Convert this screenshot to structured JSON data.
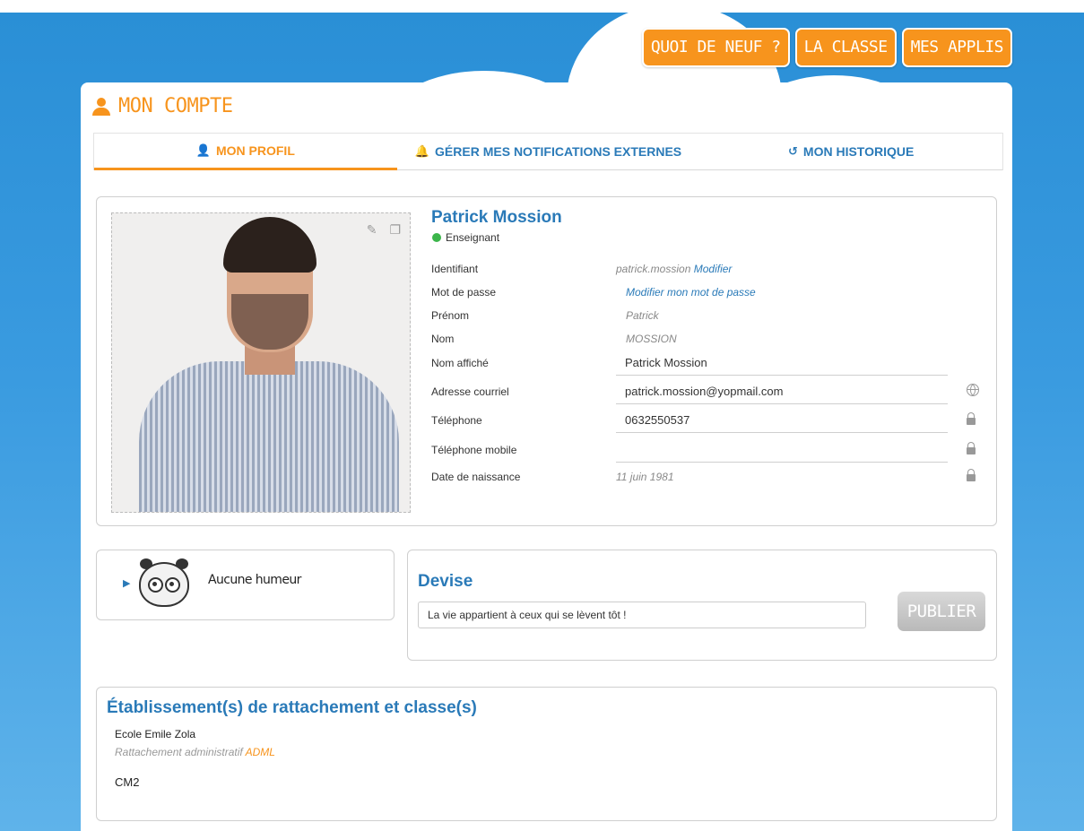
{
  "topnav": {
    "items": [
      "QUOI DE NEUF ?",
      "LA CLASSE",
      "MES APPLIS"
    ]
  },
  "page": {
    "title": "MON COMPTE"
  },
  "tabs": [
    {
      "label": "MON PROFIL",
      "icon": "user-icon",
      "active": true
    },
    {
      "label": "GÉRER MES NOTIFICATIONS EXTERNES",
      "icon": "bell-icon",
      "active": false
    },
    {
      "label": "MON HISTORIQUE",
      "icon": "history-icon",
      "active": false
    }
  ],
  "profile": {
    "name": "Patrick Mossion",
    "role": "Enseignant",
    "fields": [
      {
        "label": "Identifiant",
        "value": "patrick.mossion",
        "link": "Modifier"
      },
      {
        "label": "Mot de passe",
        "link": "Modifier mon mot de passe"
      },
      {
        "label": "Prénom",
        "value": "Patrick"
      },
      {
        "label": "Nom",
        "value": "MOSSION"
      },
      {
        "label": "Nom affiché",
        "value": "Patrick Mossion"
      },
      {
        "label": "Adresse courriel",
        "value": "patrick.mossion@yopmail.com"
      },
      {
        "label": "Téléphone",
        "value": "0632550537"
      },
      {
        "label": "Téléphone mobile",
        "value": ""
      },
      {
        "label": "Date de naissance",
        "value": "11 juin 1981"
      }
    ]
  },
  "mood": {
    "text": "Aucune humeur"
  },
  "devise": {
    "title": "Devise",
    "value": "La vie appartient à ceux qui se lèvent tôt !",
    "button": "PUBLIER"
  },
  "schools": {
    "title": "Établissement(s) de rattachement et classe(s)",
    "name": "Ecole Emile Zola",
    "link_prefix": "Rattachement administratif",
    "link": "ADML",
    "class": "CM2"
  },
  "colors": {
    "accent": "#f7941d",
    "title_blue": "#2a7ab8",
    "sky": "#3a9be0",
    "online": "#3bb54a"
  }
}
